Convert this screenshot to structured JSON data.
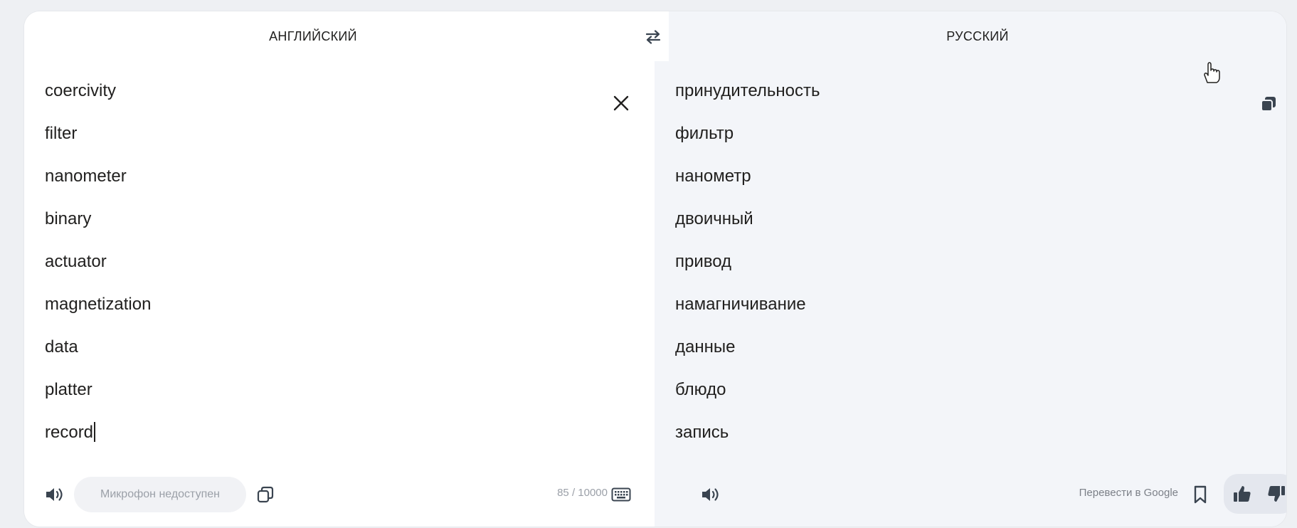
{
  "header": {
    "source_lang": "АНГЛИЙСКИЙ",
    "target_lang": "РУССКИЙ"
  },
  "source": {
    "lines": [
      "coercivity",
      "filter",
      "nanometer",
      "binary",
      "actuator",
      "magnetization",
      "data",
      "platter",
      "record"
    ],
    "mic_label": "Микрофон недоступен",
    "char_counter": "85 / 10000"
  },
  "target": {
    "lines": [
      "принудительность",
      "фильтр",
      "нанометр",
      "двоичный",
      "привод",
      "намагничивание",
      "данные",
      "блюдо",
      "запись"
    ],
    "google_link": "Перевести в Google"
  },
  "icons": {
    "swap": "swap-languages-icon",
    "clear": "close-icon",
    "speaker": "speaker-icon",
    "copy": "copy-icon",
    "keyboard": "keyboard-icon",
    "bookmark": "bookmark-icon",
    "like": "thumbs-up-icon",
    "dislike": "thumbs-down-icon"
  },
  "colors": {
    "page_bg": "#eef0f3",
    "source_bg": "#ffffff",
    "target_bg": "#f3f5f9",
    "text": "#21201f",
    "muted": "#9ba0a8",
    "icon": "#3a4450"
  }
}
